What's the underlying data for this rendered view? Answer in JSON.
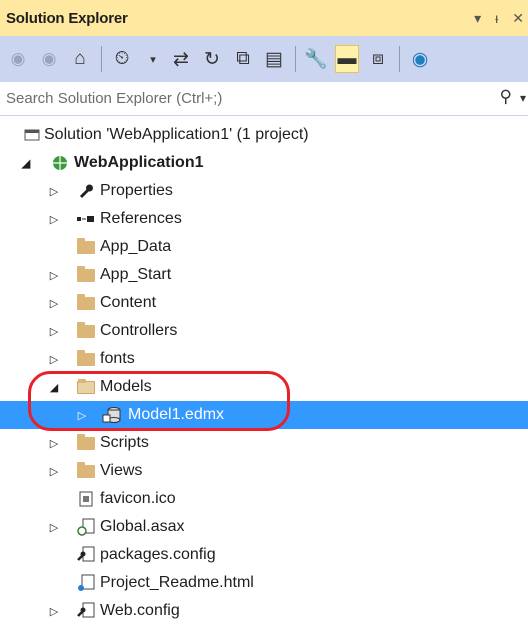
{
  "window": {
    "title": "Solution Explorer",
    "pin_icon": "pin-icon",
    "close_icon": "close-icon",
    "dropdown_icon": "dropdown-icon"
  },
  "toolbar": {
    "buttons": [
      "back-icon",
      "forward-icon",
      "home-icon",
      "history-icon",
      "sync-icon",
      "refresh-icon",
      "collapse-all-icon",
      "show-all-files-icon",
      "properties-icon",
      "preview-icon",
      "view-class-diagram-icon",
      "browser-icon"
    ]
  },
  "search": {
    "placeholder": "Search Solution Explorer (Ctrl+;)"
  },
  "tree": {
    "solution": "Solution 'WebApplication1' (1 project)",
    "project": "WebApplication1",
    "items": [
      {
        "label": "Properties"
      },
      {
        "label": "References"
      },
      {
        "label": "App_Data"
      },
      {
        "label": "App_Start"
      },
      {
        "label": "Content"
      },
      {
        "label": "Controllers"
      },
      {
        "label": "fonts"
      },
      {
        "label": "Models"
      },
      {
        "label": "Model1.edmx"
      },
      {
        "label": "Scripts"
      },
      {
        "label": "Views"
      },
      {
        "label": "favicon.ico"
      },
      {
        "label": "Global.asax"
      },
      {
        "label": "packages.config"
      },
      {
        "label": "Project_Readme.html"
      },
      {
        "label": "Web.config"
      }
    ]
  },
  "colors": {
    "title_bg": "#ffe9a0",
    "toolbar_bg": "#ccd5f0",
    "selection": "#3399ff",
    "annotation": "#e8202a"
  }
}
